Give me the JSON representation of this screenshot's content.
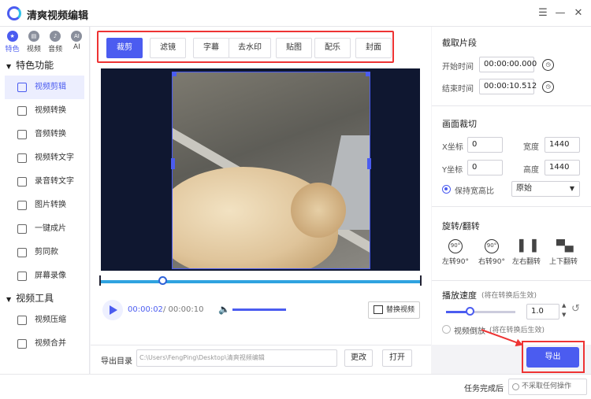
{
  "app": {
    "title": "清爽视频编辑"
  },
  "window": {
    "menu_icon": "☰",
    "minimize_icon": "—",
    "close_icon": "✕"
  },
  "category_tabs": [
    {
      "label": "特色",
      "icon": "star-icon"
    },
    {
      "label": "视频",
      "icon": "film-icon"
    },
    {
      "label": "音频",
      "icon": "audio-icon"
    },
    {
      "label": "AI",
      "icon": "ai-icon"
    }
  ],
  "sidebar": {
    "section1": "特色功能",
    "section1_items": [
      "视频剪辑",
      "视频转换",
      "音频转换",
      "视频转文字",
      "录音转文字",
      "图片转换",
      "一键成片",
      "剪同款",
      "屏幕录像"
    ],
    "section2": "视频工具",
    "section2_items": [
      "视频压缩",
      "视频合并"
    ]
  },
  "tools": [
    "裁剪",
    "滤镜",
    "字幕",
    "去水印",
    "贴图",
    "配乐",
    "封面"
  ],
  "player": {
    "current_time": "00:00:02",
    "total_time": "/ 00:00:10",
    "replace_label": "替换视频",
    "play_progress": 0.2
  },
  "output": {
    "label": "导出目录",
    "path": "C:\\Users\\FengPing\\Desktop\\清爽视频编辑",
    "change_label": "更改",
    "open_label": "打开"
  },
  "clip": {
    "title": "截取片段",
    "start_label": "开始时间",
    "start_value": "00:00:00.000",
    "end_label": "结束时间",
    "end_value": "00:00:10.512"
  },
  "crop": {
    "title": "画面裁切",
    "x_label": "X坐标",
    "x_value": "0",
    "y_label": "Y坐标",
    "y_value": "0",
    "w_label": "宽度",
    "w_value": "1440",
    "h_label": "高度",
    "h_value": "1440",
    "keep_ratio_label": "保持宽高比",
    "ratio_value": "原始"
  },
  "rotate": {
    "title": "旋转/翻转",
    "items": [
      "左转90°",
      "右转90°",
      "左右翻转",
      "上下翻转"
    ]
  },
  "speed": {
    "title": "播放速度",
    "note": "(将在转换后生效)",
    "value": "1.0",
    "reverse_label": "视频倒放",
    "reverse_note": "(将在转换后生效)"
  },
  "export_label": "导出",
  "status": {
    "label": "任务完成后",
    "option": "不采取任何操作"
  }
}
